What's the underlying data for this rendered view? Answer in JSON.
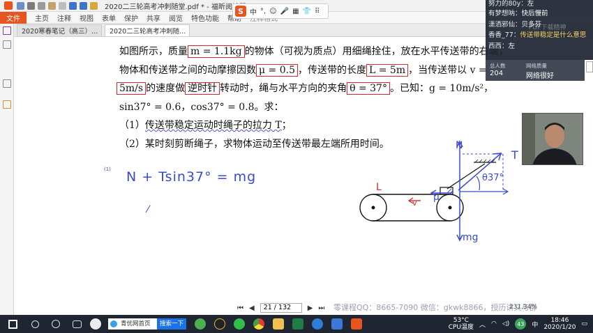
{
  "window": {
    "title": "2020二三轮高考冲刺随堂.pdf * - 福昕阅读器"
  },
  "menu": {
    "file": "文件",
    "items": [
      "主页",
      "注释",
      "视图",
      "表单",
      "保护",
      "共享",
      "阅览",
      "特色功能",
      "帮助",
      "注释格式"
    ]
  },
  "tabs": [
    {
      "label": "2020寒春笔记（高三）...",
      "close": "×"
    },
    {
      "label": "2020二三轮高考冲刺随...",
      "close": "×"
    }
  ],
  "ime": {
    "logo": "S",
    "items": [
      "中",
      "°,",
      "☺",
      "🎤",
      "▦",
      "👕",
      "⠿"
    ]
  },
  "document": {
    "line1": {
      "a": "如图所示，质量",
      "m": "m = 1.1kg",
      "b": "的物体（可视为质点）用细绳拴住，放在水平传送带的右端，"
    },
    "line2": {
      "a": "物体和传送带之间的动摩擦因数",
      "mu": "μ = 0.5",
      "b": "，传送带的长度",
      "L": "L = 5m",
      "c": "，当传送带以 v ="
    },
    "line3": {
      "v": "5m/s",
      "a": "的速度做",
      "ccw": "逆时针",
      "b": "转动时，绳与水平方向的夹角",
      "theta": "θ = 37°",
      "c": "。已知：g = 10m/s²，"
    },
    "line4": "sin37°  = 0.6，cos37°  = 0.8。求：",
    "q1": {
      "num": "（1）",
      "a": "传送带稳定运动时绳子的拉力",
      "T": " T",
      "end": "；"
    },
    "q2": "（2）某时刻剪断绳子，求物体运动至传送带最左端所用时间。"
  },
  "handwriting": {
    "label1": "(1)",
    "eq1": "N + Tsin37° = mg",
    "N": "N",
    "T": "T",
    "angle": "θ37°",
    "L": "L",
    "v": "v",
    "mu": "μ",
    "mg": "mg"
  },
  "pagenav": {
    "page": "21 / 132",
    "first": "⏮",
    "prev": "◀",
    "next": "▶",
    "last": "⏭"
  },
  "watermark": "零课程QQ：8665-7090 微信：gkwk8866，授历讲义与群",
  "zoom": "231.34%",
  "taskbar": {
    "search_text": "青优网首页",
    "search_btn": "搜索一下",
    "temp": "53°C",
    "cpu": "CPU温度",
    "badge": "43",
    "lang": "中",
    "time": "18:46",
    "date": "2020/1/20"
  },
  "chat": {
    "messages": [
      {
        "user": "努力的80y：",
        "msg": "左"
      },
      {
        "user": "有梦想呐：",
        "msg": "快后慢前"
      },
      {
        "user": "潇洒邪仙：",
        "msg": "贝多芬"
      },
      {
        "user": "香香_77：",
        "msg": "传送带稳定是什么意思"
      },
      {
        "user": "西西：",
        "msg": "左"
      }
    ],
    "overlay": "PDF下载精神"
  },
  "stats": {
    "count_label": "总人数",
    "count": "204",
    "net_label": "网络质量",
    "net": "网络很好"
  },
  "colors": {
    "accent": "#e8541f",
    "box": "#e0242b",
    "ink": "#3a4ad0",
    "taskbar": "#1f2631"
  }
}
